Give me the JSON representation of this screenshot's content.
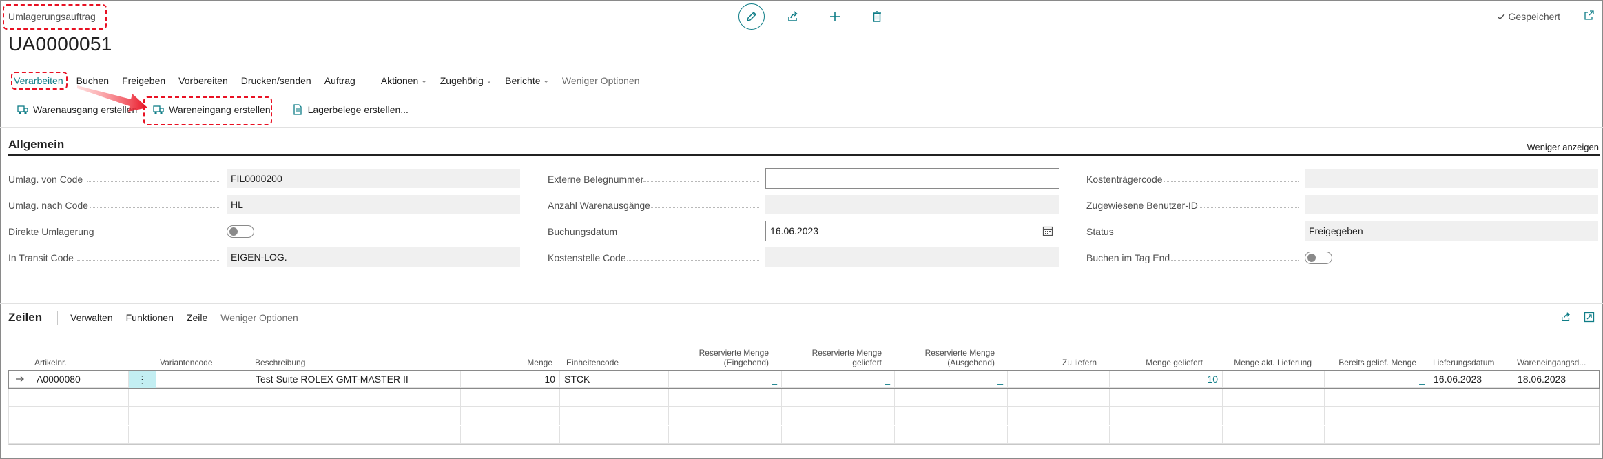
{
  "header": {
    "entity_type": "Umlagerungsauftrag",
    "record_no": "UA0000051",
    "saved_label": "Gespeichert",
    "top_actions": [
      "edit-icon",
      "share-icon",
      "new-icon",
      "delete-icon"
    ]
  },
  "actionbar": {
    "items": [
      {
        "label": "Verarbeiten",
        "active": true
      },
      {
        "label": "Buchen"
      },
      {
        "label": "Freigeben"
      },
      {
        "label": "Vorbereiten"
      },
      {
        "label": "Drucken/senden"
      },
      {
        "label": "Auftrag"
      },
      {
        "label": "Aktionen",
        "dropdown": true
      },
      {
        "label": "Zugehörig",
        "dropdown": true
      },
      {
        "label": "Berichte",
        "dropdown": true
      },
      {
        "label": "Weniger Optionen",
        "muted": true
      }
    ]
  },
  "subbar": {
    "items": [
      {
        "label": "Warenausgang erstellen"
      },
      {
        "label": "Wareneingang erstellen"
      },
      {
        "label": "Lagerbelege erstellen..."
      }
    ]
  },
  "allgemein": {
    "title": "Allgemein",
    "show_less": "Weniger anzeigen",
    "col1": [
      {
        "label": "Umlag. von Code",
        "value": "FIL0000200"
      },
      {
        "label": "Umlag. nach Code",
        "value": "HL"
      },
      {
        "label": "Direkte Umlagerung",
        "value": ""
      },
      {
        "label": "In Transit Code",
        "value": "EIGEN-LOG."
      }
    ],
    "col2": [
      {
        "label": "Externe Belegnummer",
        "value": ""
      },
      {
        "label": "Anzahl Warenausgänge",
        "value": ""
      },
      {
        "label": "Buchungsdatum",
        "value": "16.06.2023"
      },
      {
        "label": "Kostenstelle Code",
        "value": ""
      }
    ],
    "col3": [
      {
        "label": "Kostenträgercode",
        "value": ""
      },
      {
        "label": "Zugewiesene Benutzer-ID",
        "value": ""
      },
      {
        "label": "Status",
        "value": "Freigegeben"
      },
      {
        "label": "Buchen im Tag End",
        "value": ""
      }
    ]
  },
  "zeilen": {
    "title": "Zeilen",
    "items": [
      "Verwalten",
      "Funktionen",
      "Zeile",
      "Weniger Optionen"
    ],
    "columns": [
      "Artikelnr.",
      "Variantencode",
      "Beschreibung",
      "Menge",
      "Einheitencode",
      "Reservierte Menge (Eingehend)",
      "Reservierte Menge geliefert",
      "Reservierte Menge (Ausgehend)",
      "Zu liefern",
      "Menge geliefert",
      "Menge akt. Lieferung",
      "Bereits gelief. Menge",
      "Lieferungsdatum",
      "Wareneingangsd..."
    ],
    "rows": [
      {
        "artikelnr": "A0000080",
        "variantencode": "",
        "beschreibung": "Test Suite ROLEX GMT-MASTER II",
        "menge": "10",
        "einheit": "STCK",
        "res_ein": "_",
        "res_gel": "_",
        "res_aus": "_",
        "zu_liefern": "",
        "menge_gel": "10",
        "menge_akt": "",
        "bereits": "_",
        "lieferdatum": "16.06.2023",
        "weingang": "18.06.2023"
      }
    ]
  },
  "colors": {
    "accent": "#0f7d87",
    "annotation": "#e81123"
  }
}
